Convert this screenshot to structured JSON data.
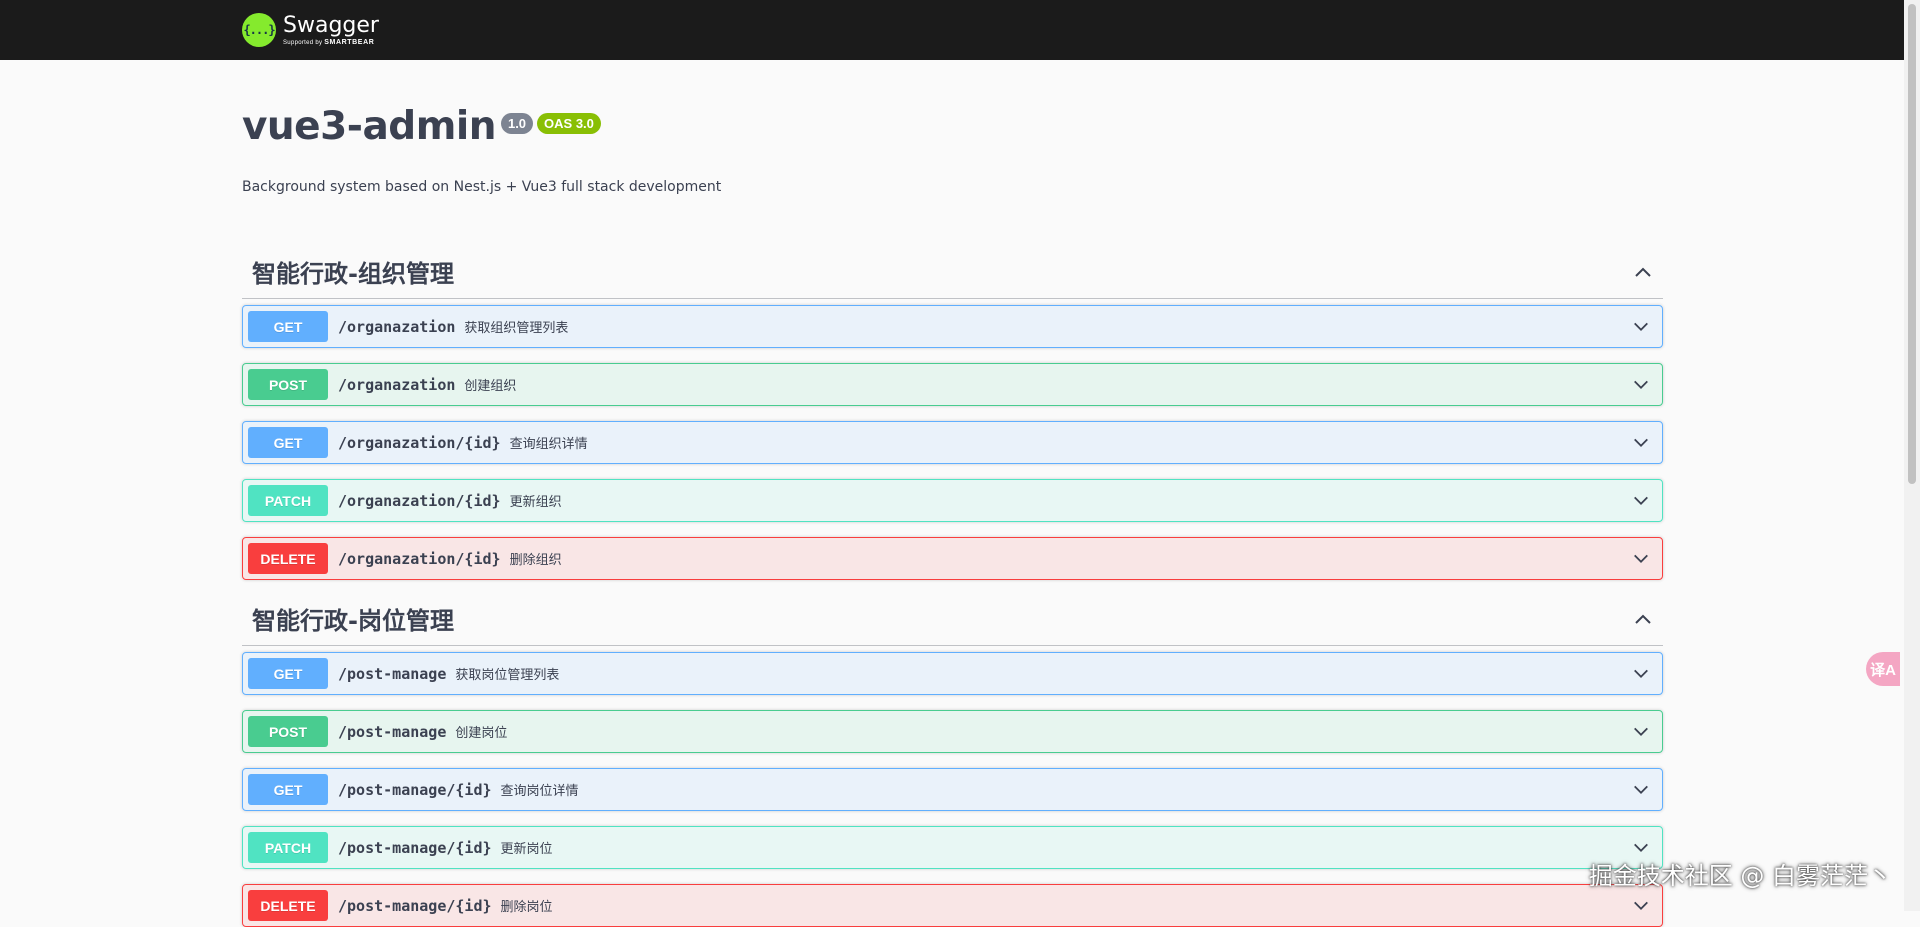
{
  "topbar": {
    "logo_glyph": "{...}",
    "logo_name": "Swagger",
    "logo_sub_prefix": "Supported by",
    "logo_sub_brand": "SMARTBEAR"
  },
  "info": {
    "title": "vue3-admin",
    "version": "1.0",
    "oas": "OAS 3.0",
    "description": "Background system based on Nest.js + Vue3 full stack development"
  },
  "tags": [
    {
      "name": "智能行政-组织管理",
      "expanded": true,
      "operations": [
        {
          "method": "GET",
          "path": "/organazation",
          "summary": "获取组织管理列表"
        },
        {
          "method": "POST",
          "path": "/organazation",
          "summary": "创建组织"
        },
        {
          "method": "GET",
          "path": "/organazation/{id}",
          "summary": "查询组织详情"
        },
        {
          "method": "PATCH",
          "path": "/organazation/{id}",
          "summary": "更新组织"
        },
        {
          "method": "DELETE",
          "path": "/organazation/{id}",
          "summary": "删除组织"
        }
      ]
    },
    {
      "name": "智能行政-岗位管理",
      "expanded": true,
      "operations": [
        {
          "method": "GET",
          "path": "/post-manage",
          "summary": "获取岗位管理列表"
        },
        {
          "method": "POST",
          "path": "/post-manage",
          "summary": "创建岗位"
        },
        {
          "method": "GET",
          "path": "/post-manage/{id}",
          "summary": "查询岗位详情"
        },
        {
          "method": "PATCH",
          "path": "/post-manage/{id}",
          "summary": "更新岗位"
        },
        {
          "method": "DELETE",
          "path": "/post-manage/{id}",
          "summary": "删除岗位"
        }
      ]
    }
  ],
  "colors": {
    "topbar_bg": "#1b1b1b",
    "logo_green": "#85ea2d",
    "get": "#61affe",
    "post": "#49cc90",
    "patch": "#50e3c2",
    "delete": "#f93e3e",
    "oas_badge": "#89bf04",
    "version_badge": "#7d8492"
  },
  "overlay": {
    "translate_label": "译A",
    "watermark": "掘金技术社区 @ 白雾茫茫丶"
  }
}
